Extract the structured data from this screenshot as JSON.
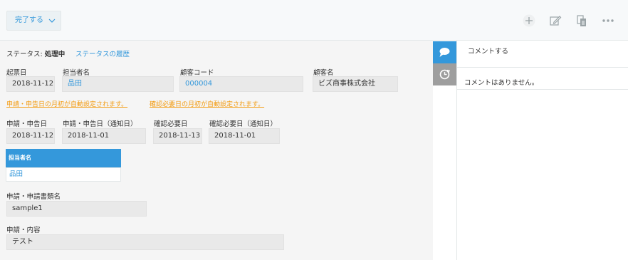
{
  "toolbar": {
    "action_label": "完了する",
    "icons": [
      "plus-icon",
      "edit-icon",
      "copy-icon",
      "more-icon"
    ]
  },
  "status": {
    "label": "ステータス:",
    "value": "処理中",
    "history_link": "ステータスの履歴"
  },
  "row1": {
    "kihyo_label": "起票日",
    "kihyo_value": "2018-11-12",
    "tantou_label": "担当者名",
    "tantou_value": "品田",
    "code_label": "顧客コード",
    "code_value": "000004",
    "kokyaku_label": "顧客名",
    "kokyaku_value": "ビズ商事株式会社"
  },
  "notes": {
    "note1": "申請・申告日の月初が自動設定されます。",
    "note2": "確認必要日の月初が自動設定されます。"
  },
  "row2": {
    "shinsei_label": "申請・申告日",
    "shinsei_value": "2018-11-12",
    "tsuchi_label": "申請・申告日（通知日）",
    "tsuchi_value": "2018-11-01",
    "kakunin_label": "確認必要日",
    "kakunin_value": "2018-11-13",
    "kakunin_tsuchi_label": "確認必要日（通知日）",
    "kakunin_tsuchi_value": "2018-11-01"
  },
  "subtable": {
    "header": "担当者名",
    "value": "品田"
  },
  "doc": {
    "label": "申請・申請書類名",
    "value": "sample1"
  },
  "content": {
    "label": "申請・内容",
    "value": "テスト"
  },
  "comments": {
    "input_placeholder": "コメントする",
    "empty_text": "コメントはありません。"
  },
  "colors": {
    "accent": "#3498db",
    "note": "#f39c12",
    "tab_inactive": "#9e9e9e"
  }
}
